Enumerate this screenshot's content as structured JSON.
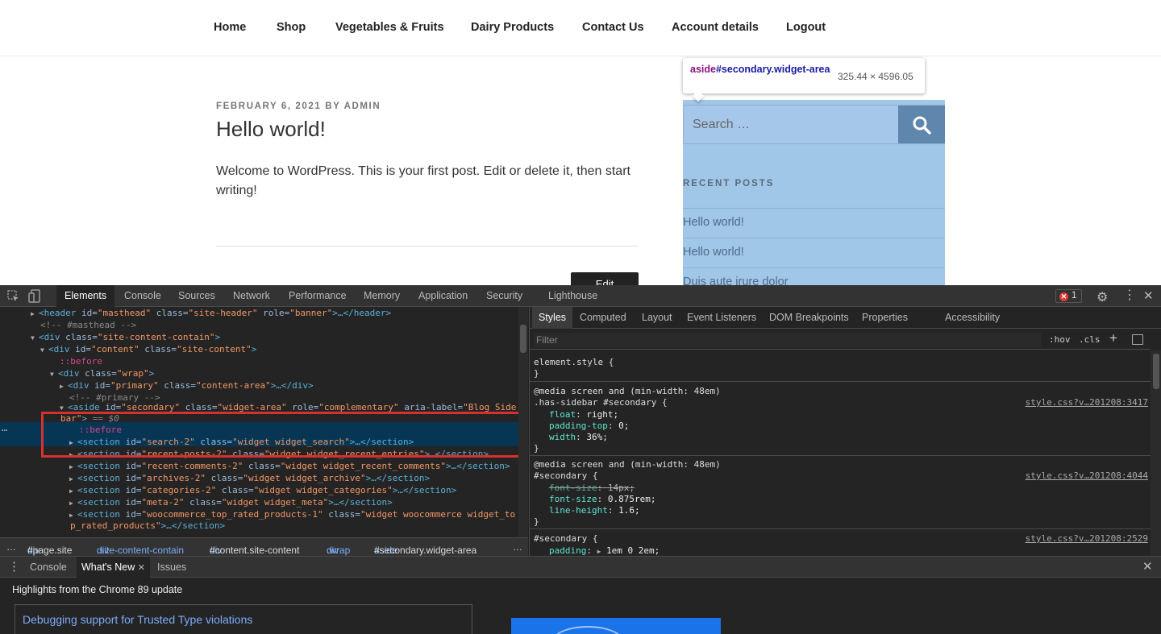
{
  "site": {
    "nav": [
      "Home",
      "Shop",
      "Vegetables & Fruits",
      "Dairy Products",
      "Contact Us",
      "Account details",
      "Logout"
    ],
    "post": {
      "date": "FEBRUARY 6, 2021",
      "by": "BY",
      "author": "ADMIN",
      "title": "Hello world!",
      "body": "Welcome to WordPress. This is your first post. Edit or delete it, then start writing!",
      "edit": "Edit"
    },
    "sidebar": {
      "search_placeholder": "Search …",
      "widget_title": "RECENT POSTS",
      "recent_posts": [
        "Hello world!",
        "Hello world!",
        "Duis aute irure dolor"
      ]
    },
    "tooltip": {
      "tag": "aside",
      "id": "#secondary.widget-area",
      "size": "325.44 × 4596.05"
    }
  },
  "devtools": {
    "tabs": [
      "Elements",
      "Console",
      "Sources",
      "Network",
      "Performance",
      "Memory",
      "Application",
      "Security",
      "Lighthouse"
    ],
    "active_tab": "Elements",
    "error_count": "1",
    "dom": {
      "l1": {
        "open": "<header",
        "a1": " id=",
        "v1": "\"masthead\"",
        "a2": " class=",
        "v2": "\"site-header\"",
        "a3": " role=",
        "v3": "\"banner\"",
        "close": ">…</header>"
      },
      "l2": "<!-- #masthead -->",
      "l3": {
        "open": "<div",
        "a1": " class=",
        "v1": "\"site-content-contain\"",
        "close": ">"
      },
      "l4": {
        "open": "<div",
        "a1": " id=",
        "v1": "\"content\"",
        "a2": " class=",
        "v2": "\"site-content\"",
        "close": ">"
      },
      "l5": "::before",
      "l6": {
        "open": "<div",
        "a1": " class=",
        "v1": "\"wrap\"",
        "close": ">"
      },
      "l7": {
        "open": "<div",
        "a1": " id=",
        "v1": "\"primary\"",
        "a2": " class=",
        "v2": "\"content-area\"",
        "close": ">…</div>"
      },
      "l8": "<!-- #primary -->",
      "l9": {
        "open": "<aside",
        "a1": " id=",
        "v1": "\"secondary\"",
        "a2": " class=",
        "v2": "\"widget-area\"",
        "a3": " role=",
        "v3": "\"complementary\"",
        "a4": " aria-label=",
        "v4": "\"Blog Side"
      },
      "l9b": {
        "v4b": "bar\"",
        "close": ">",
        "eq": " == $0"
      },
      "l10": "::before",
      "l11": {
        "open": "<section",
        "a1": " id=",
        "v1": "\"search-2\"",
        "a2": " class=",
        "v2": "\"widget widget_search\"",
        "close": ">…</section>"
      },
      "l12": {
        "open": "<section",
        "a1": " id=",
        "v1": "\"recent-posts-2\"",
        "a2": " class=",
        "v2": "\"widget widget_recent_entries\"",
        "close": ">…</section>"
      },
      "l13": {
        "open": "<section",
        "a1": " id=",
        "v1": "\"recent-comments-2\"",
        "a2": " class=",
        "v2": "\"widget widget_recent_comments\"",
        "close": ">…</section>"
      },
      "l14": {
        "open": "<section",
        "a1": " id=",
        "v1": "\"archives-2\"",
        "a2": " class=",
        "v2": "\"widget widget_archive\"",
        "close": ">…</section>"
      },
      "l15": {
        "open": "<section",
        "a1": " id=",
        "v1": "\"categories-2\"",
        "a2": " class=",
        "v2": "\"widget widget_categories\"",
        "close": ">…</section>"
      },
      "l16": {
        "open": "<section",
        "a1": " id=",
        "v1": "\"meta-2\"",
        "a2": " class=",
        "v2": "\"widget widget_meta\"",
        "close": ">…</section>"
      },
      "l17": {
        "open": "<section",
        "a1": " id=",
        "v1": "\"woocommerce_top_rated_products-1\"",
        "a2": " class=",
        "v2": "\"widget woocommerce widget_to"
      },
      "l17b": {
        "v2b": "p_rated_products\"",
        "close": ">…</section>"
      }
    },
    "breadcrumbs": [
      {
        "tag": "div",
        "rest": "#page.site"
      },
      {
        "tag": "div",
        "rest": ".site-content-contain"
      },
      {
        "tag": "div",
        "rest": "#content.site-content"
      },
      {
        "tag": "div",
        "rest": ".wrap"
      },
      {
        "tag": "aside",
        "rest": "#secondary.widget-area"
      }
    ],
    "styles_tabs": [
      "Styles",
      "Computed",
      "Layout",
      "Event Listeners",
      "DOM Breakpoints",
      "Properties",
      "Accessibility"
    ],
    "filter_placeholder": "Filter",
    "hov": ":hov",
    "cls": ".cls",
    "rules": {
      "r0": {
        "selector": "element.style {",
        "close": "}"
      },
      "r1": {
        "media": "@media screen and (min-width: 48em)",
        "selector": ".has-sidebar #secondary {",
        "source": "style.css?v…201208:3417",
        "p1n": "float",
        "p1v": "right;",
        "p2n": "padding-top",
        "p2v": "0;",
        "p3n": "width",
        "p3v": "36%;",
        "close": "}"
      },
      "r2": {
        "media": "@media screen and (min-width: 48em)",
        "selector": "#secondary {",
        "source": "style.css?v…201208:4044",
        "p1n": "font-size",
        "p1v": "14px;",
        "p2n": "font-size",
        "p2v": "0.875rem;",
        "p3n": "line-height",
        "p3v": "1.6;",
        "close": "}"
      },
      "r3": {
        "selector": "#secondary {",
        "source": "style.css?v…201208:2529",
        "p1n": "padding",
        "p1v": "1em 0 2em;"
      }
    },
    "drawer": {
      "tabs": [
        "Console",
        "What's New",
        "Issues"
      ],
      "active": "What's New",
      "heading": "Highlights from the Chrome 89 update",
      "link": "Debugging support for Trusted Type violations"
    }
  },
  "colors": {
    "accent_highlight": "#6fa8dc",
    "selection": "#073655",
    "red_box": "#d63131"
  }
}
